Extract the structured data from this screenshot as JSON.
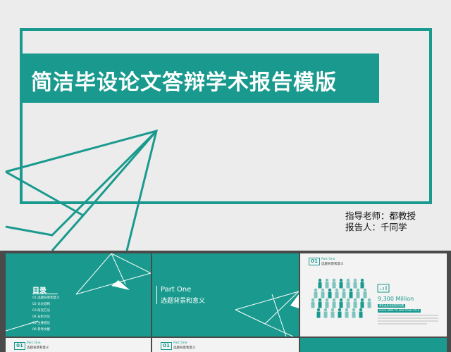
{
  "main_slide": {
    "title": "简洁毕设论文答辩学术报告模版",
    "advisor": "指导老师：都教授",
    "reporter": "报告人：千同学"
  },
  "thumb_toc": {
    "title": "目录",
    "items": [
      "01 选题背景和意义",
      "02 论文结构",
      "03 研究方法",
      "04 分析讨论",
      "05 主要结论",
      "06 参考文献"
    ]
  },
  "thumb_part_one": {
    "title": "Part One",
    "subtitle": "选题背景和意义"
  },
  "thumb_stats": {
    "number": "01",
    "part": "Part One",
    "subtitle": "选题背景和意义",
    "value": "9,300 Million",
    "pill1": "请在此处添加您的标题",
    "pill2": "CLICK HERE TO ADD YOUR TITLE"
  },
  "thumb_bottom1": {
    "number": "01",
    "part": "Part One",
    "subtitle": "选题背景和意义"
  },
  "thumb_bottom2": {
    "number": "01",
    "part": "Part One",
    "subtitle": "选题背景和意义"
  },
  "colors": {
    "accent": "#1a9a8e",
    "background": "#ececec",
    "frame": "#4a4a4a"
  }
}
